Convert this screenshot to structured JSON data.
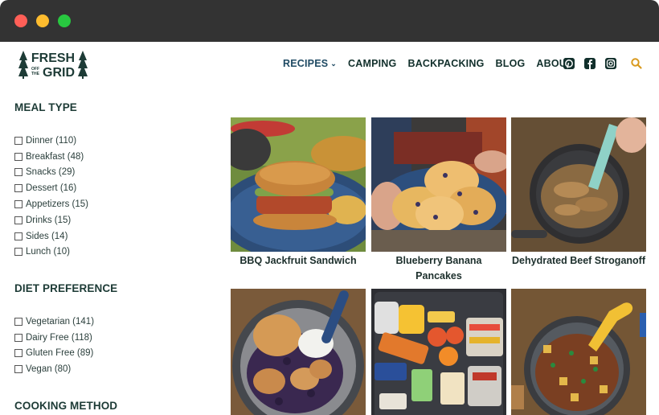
{
  "header": {
    "logo_text": "FRESH OFF THE GRID",
    "nav": [
      {
        "label": "RECIPES",
        "has_dropdown": true
      },
      {
        "label": "CAMPING"
      },
      {
        "label": "BACKPACKING"
      },
      {
        "label": "BLOG"
      },
      {
        "label": "ABOUT"
      }
    ],
    "icons": [
      "pinterest-icon",
      "facebook-icon",
      "instagram-icon",
      "search-icon"
    ]
  },
  "sidebar": {
    "meal_type": {
      "title": "MEAL TYPE",
      "items": [
        "Dinner (110)",
        "Breakfast (48)",
        "Snacks (29)",
        "Dessert (16)",
        "Appetizers (15)",
        "Drinks (15)",
        "Sides (14)",
        "Lunch (10)"
      ]
    },
    "diet_preference": {
      "title": "DIET PREFERENCE",
      "items": [
        "Vegetarian (141)",
        "Dairy Free (118)",
        "Gluten Free (89)",
        "Vegan (80)"
      ]
    },
    "cooking_method": {
      "title": "COOKING METHOD"
    }
  },
  "recipes": [
    {
      "title": "BBQ Jackfruit Sandwich"
    },
    {
      "title": "Blueberry Banana Pancakes"
    },
    {
      "title": "Dehydrated Beef Stroganoff"
    },
    {
      "title": ""
    },
    {
      "title": ""
    },
    {
      "title": ""
    }
  ],
  "colors": {
    "brand_dark": "#1d3b36",
    "nav_active": "#1f4a63",
    "search_accent": "#d99a1e",
    "chrome": "#333333"
  }
}
